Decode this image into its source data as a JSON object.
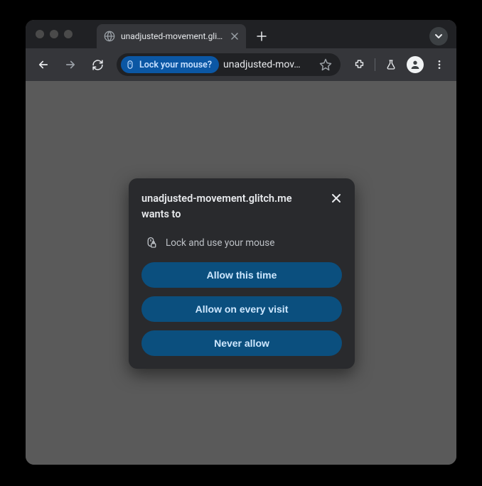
{
  "tab": {
    "title": "unadjusted-movement.glitch."
  },
  "omnibox": {
    "chip_label": "Lock your mouse?",
    "url_display": "unadjusted-mov…"
  },
  "dialog": {
    "title": "unadjusted-movement.glitch.me wants to",
    "permission_label": "Lock and use your mouse",
    "buttons": {
      "allow_once": "Allow this time",
      "allow_every": "Allow on every visit",
      "never": "Never allow"
    }
  }
}
